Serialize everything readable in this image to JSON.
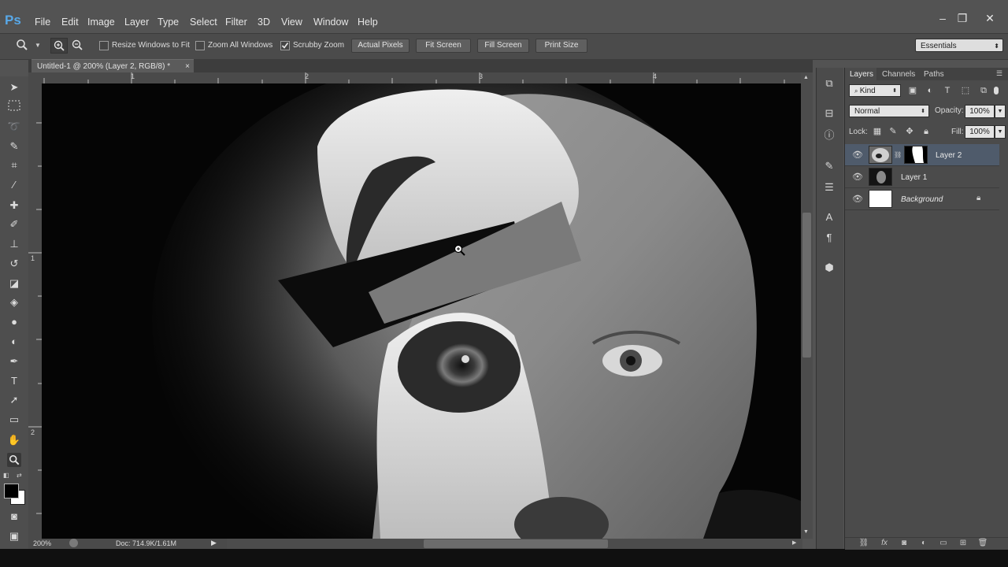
{
  "app": {
    "logo": "Ps"
  },
  "menu": [
    "File",
    "Edit",
    "Image",
    "Layer",
    "Type",
    "Select",
    "Filter",
    "3D",
    "View",
    "Window",
    "Help"
  ],
  "window_controls": [
    "–",
    "❐",
    "✕"
  ],
  "options": {
    "resize_windows": "Resize Windows to Fit",
    "zoom_all": "Zoom All Windows",
    "scrubby_zoom": "Scrubby Zoom",
    "actual_pixels": "Actual Pixels",
    "fit_screen": "Fit Screen",
    "fill_screen": "Fill Screen",
    "print_size": "Print Size",
    "workspace": "Essentials"
  },
  "document": {
    "tab_title": "Untitled-1 @ 200% (Layer 2, RGB/8) *",
    "ruler_top": [
      "1",
      "2",
      "3",
      "4"
    ],
    "ruler_left": [
      "1",
      "2"
    ]
  },
  "status": {
    "zoom": "200%",
    "doc_info": "Doc: 714.9K/1.61M"
  },
  "layers_panel": {
    "tabs": [
      "Layers",
      "Channels",
      "Paths"
    ],
    "filter": "Kind",
    "blend_mode": "Normal",
    "opacity_label": "Opacity:",
    "opacity_value": "100%",
    "lock_label": "Lock:",
    "fill_label": "Fill:",
    "fill_value": "100%",
    "layers": [
      "Layer 2",
      "Layer 1",
      "Background"
    ],
    "selected": "Layer 2"
  },
  "colors": {
    "accent": "#58a8e8",
    "selected_row": "#4f5b6b",
    "panel_bg": "#4b4b4b"
  }
}
